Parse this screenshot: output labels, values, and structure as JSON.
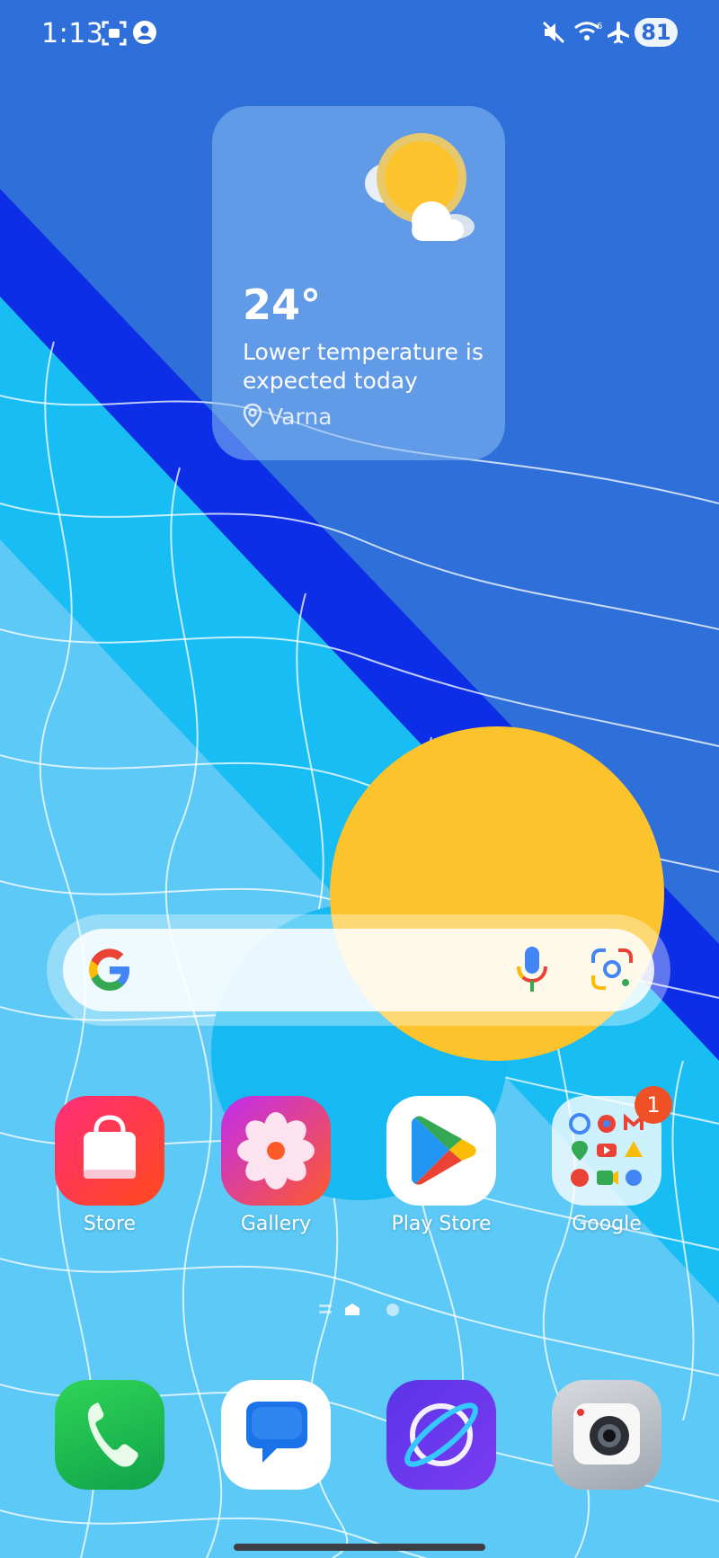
{
  "status_bar": {
    "time": "1:13",
    "battery": "81",
    "icons": [
      "screen-record-icon",
      "account-icon",
      "mute-icon",
      "wifi-icon",
      "airplane-icon"
    ]
  },
  "weather": {
    "temperature": "24°",
    "description": "Lower temperature is expected today",
    "location": "Varna"
  },
  "search": {
    "icons": [
      "google-icon",
      "mic-icon",
      "lens-icon"
    ]
  },
  "apps": [
    {
      "label": "Store",
      "icon": "store-icon"
    },
    {
      "label": "Gallery",
      "icon": "gallery-icon"
    },
    {
      "label": "Play Store",
      "icon": "play-store-icon"
    },
    {
      "label": "Google",
      "icon": "google-folder-icon",
      "badge": "1"
    }
  ],
  "dock": [
    {
      "icon": "phone-icon"
    },
    {
      "icon": "messages-icon"
    },
    {
      "icon": "browser-icon"
    },
    {
      "icon": "camera-icon"
    }
  ],
  "colors": {
    "wallpaper_blue": "#2e6ad6",
    "wallpaper_cyan": "#19bff5",
    "sun_yellow": "#fcc32c",
    "badge_red": "#ef5026"
  }
}
